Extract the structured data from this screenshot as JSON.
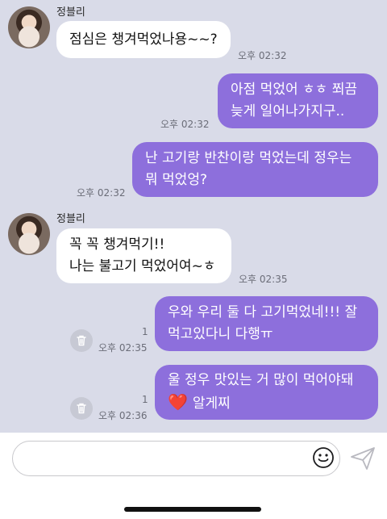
{
  "sender": {
    "name": "정블리"
  },
  "messages": [
    {
      "dir": "in",
      "lines": [
        "점심은 챙겨먹었나용~~?"
      ],
      "time": "오후 02:32"
    },
    {
      "dir": "out",
      "lines": [
        "아점 먹었어 ㅎㅎ 쬐끔",
        "늦게 일어나가지구.."
      ],
      "time": "오후 02:32"
    },
    {
      "dir": "out",
      "lines": [
        "난 고기랑 반찬이랑 먹었는데 정우는",
        "뭐 먹었엉?"
      ],
      "time": "오후 02:32"
    },
    {
      "dir": "in",
      "lines": [
        "꼭 꼭 챙겨먹기!!",
        "나는 불고기 먹었어여~ㅎ"
      ],
      "time": "오후 02:35"
    },
    {
      "dir": "out",
      "lines": [
        "우와 우리 둘 다 고기먹었네!!! 잘",
        "먹고있다니 다행ㅠ"
      ],
      "time": "오후 02:35",
      "unread": "1"
    },
    {
      "dir": "out",
      "lines": [
        "울 정우 맛있는 거 많이 먹어야돼",
        "알게찌"
      ],
      "heart": "❤️",
      "time": "오후 02:36",
      "unread": "1"
    }
  ],
  "input": {
    "placeholder": ""
  },
  "icons": {
    "emoji": "smiley-icon",
    "send": "send-arrow-icon",
    "delete": "trash-icon"
  },
  "colors": {
    "background": "#d9dbe8",
    "outgoing": "#8d6fdc",
    "incoming": "#ffffff"
  }
}
